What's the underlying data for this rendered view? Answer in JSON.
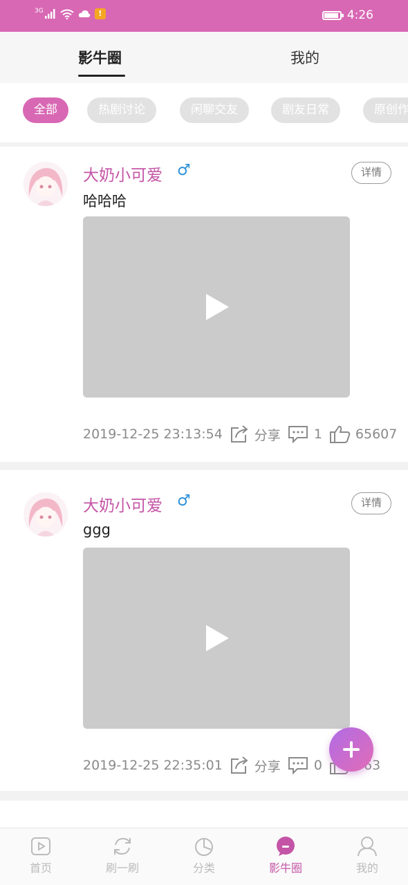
{
  "status_bar": {
    "network": "3G",
    "time": "4:26",
    "warning": "!"
  },
  "top_tabs": [
    {
      "label": "影牛圈",
      "active": true
    },
    {
      "label": "我的",
      "active": false
    }
  ],
  "filters": [
    {
      "label": "全部",
      "active": true
    },
    {
      "label": "热剧讨论",
      "active": false
    },
    {
      "label": "闲聊交友",
      "active": false
    },
    {
      "label": "剧友日常",
      "active": false
    },
    {
      "label": "原创作",
      "active": false
    }
  ],
  "posts": [
    {
      "username": "大奶小可爱",
      "gender": "♂",
      "detail_label": "详情",
      "text": "哈哈哈",
      "timestamp": "2019-12-25 23:13:54",
      "share_label": "分享",
      "comments": "1",
      "likes": "65607"
    },
    {
      "username": "大奶小可爱",
      "gender": "♂",
      "detail_label": "详情",
      "text": "ggg",
      "timestamp": "2019-12-25 22:35:01",
      "share_label": "分享",
      "comments": "0",
      "likes": "563"
    }
  ],
  "bottom_nav": [
    {
      "label": "首页",
      "icon": "play-icon",
      "active": false
    },
    {
      "label": "刷一刷",
      "icon": "refresh-icon",
      "active": false
    },
    {
      "label": "分类",
      "icon": "pie-chart-icon",
      "active": false
    },
    {
      "label": "影牛圈",
      "icon": "chat-bubble-icon",
      "active": true
    },
    {
      "label": "我的",
      "icon": "user-icon",
      "active": false
    }
  ],
  "colors": {
    "accent": "#d868b4",
    "username": "#c455a6",
    "gender": "#2b8fd8",
    "video_placeholder": "#cbcbcb"
  }
}
